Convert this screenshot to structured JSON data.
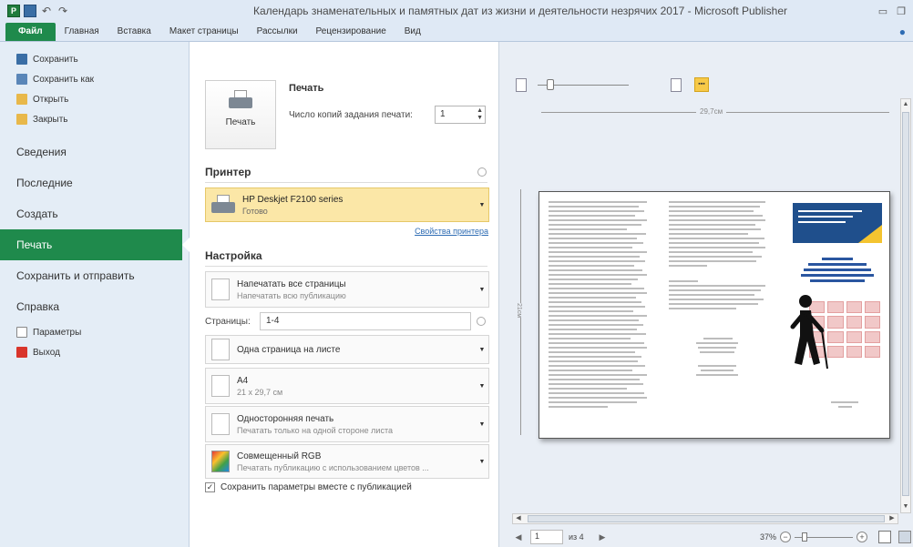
{
  "window": {
    "title": "Календарь знаменательных и памятных дат из жизни и деятельности незрячих 2017 - Microsoft Publisher"
  },
  "ribbon": {
    "tabs": [
      "Файл",
      "Главная",
      "Вставка",
      "Макет страницы",
      "Рассылки",
      "Рецензирование",
      "Вид"
    ]
  },
  "nav": {
    "small_top": [
      {
        "label": "Сохранить",
        "icon": "save-icon"
      },
      {
        "label": "Сохранить как",
        "icon": "save-as-icon"
      },
      {
        "label": "Открыть",
        "icon": "open-folder-icon"
      },
      {
        "label": "Закрыть",
        "icon": "close-folder-icon"
      }
    ],
    "big": [
      "Сведения",
      "Последние",
      "Создать",
      "Печать",
      "Сохранить и отправить",
      "Справка"
    ],
    "active": "Печать",
    "small_bottom": [
      {
        "label": "Параметры",
        "icon": "options-icon"
      },
      {
        "label": "Выход",
        "icon": "exit-icon"
      }
    ]
  },
  "print": {
    "button_label": "Печать",
    "title": "Печать",
    "copies_label": "Число копий задания печати:",
    "copies_value": "1",
    "printer_heading": "Принтер",
    "printer_name": "HP Deskjet F2100 series",
    "printer_status": "Готово",
    "printer_props": "Свойства принтера",
    "settings_heading": "Настройка",
    "settings": [
      {
        "main": "Напечатать все страницы",
        "sub": "Напечатать всю публикацию"
      },
      {
        "main": "Одна страница на листе",
        "sub": ""
      },
      {
        "main": "A4",
        "sub": "21 x 29,7 см"
      },
      {
        "main": "Односторонняя печать",
        "sub": "Печатать только на одной стороне листа"
      },
      {
        "main": "Совмещенный RGB",
        "sub": "Печатать публикацию с использованием цветов ..."
      }
    ],
    "pages_label": "Страницы:",
    "pages_value": "1-4",
    "save_params_label": "Сохранить параметры вместе с публикацией",
    "save_params_checked": "✓"
  },
  "preview": {
    "width_label": "29,7см",
    "height_label": "21см",
    "page_current": "1",
    "page_of": "из 4",
    "zoom": "37%"
  }
}
